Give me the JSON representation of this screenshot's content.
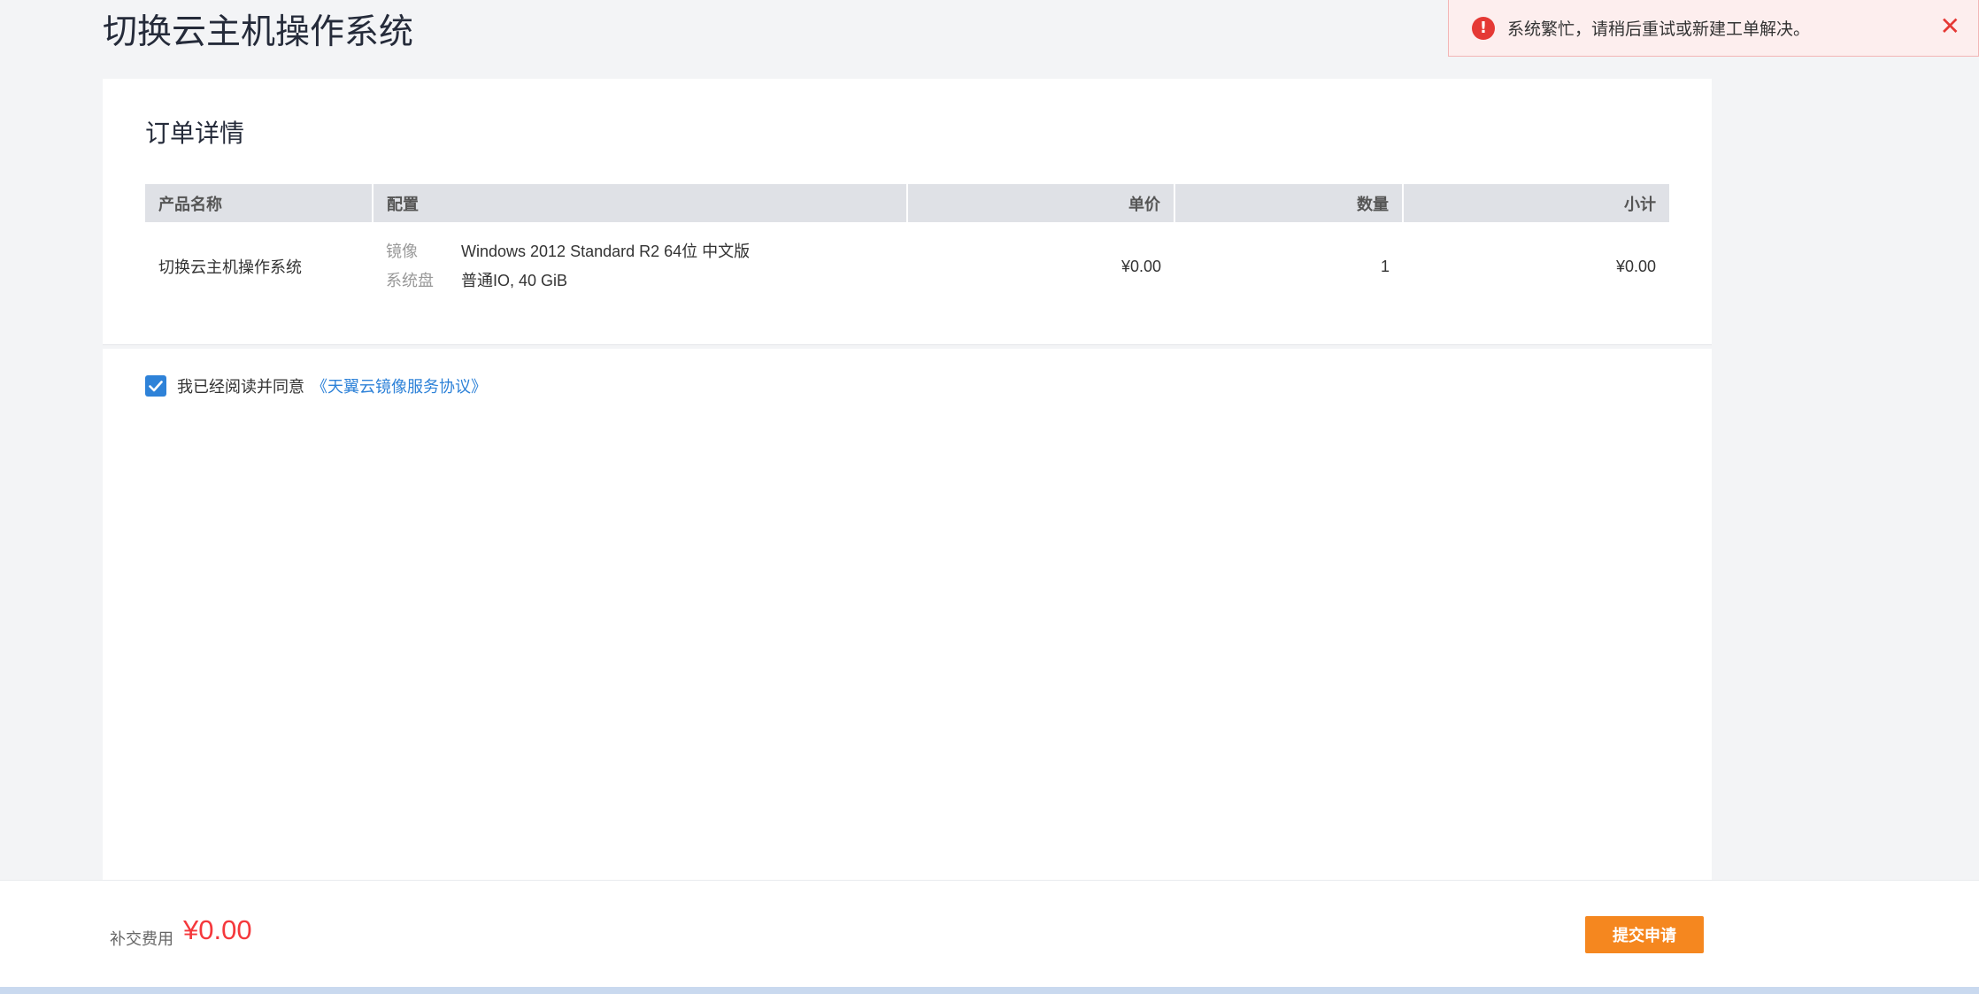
{
  "page": {
    "title": "切换云主机操作系统"
  },
  "toast": {
    "message": "系统繁忙，请稍后重试或新建工单解决。",
    "icon": "error-icon",
    "close_icon": "close-icon"
  },
  "order": {
    "title": "订单详情",
    "columns": {
      "product": "产品名称",
      "config": "配置",
      "unit_price": "单价",
      "quantity": "数量",
      "subtotal": "小计"
    },
    "row": {
      "product": "切换云主机操作系统",
      "config": [
        {
          "key": "镜像",
          "value": "Windows 2012 Standard R2 64位 中文版"
        },
        {
          "key": "系统盘",
          "value": "普通IO, 40 GiB"
        }
      ],
      "unit_price": "¥0.00",
      "quantity": "1",
      "subtotal": "¥0.00"
    }
  },
  "agreement": {
    "checked": true,
    "text": "我已经阅读并同意",
    "link": "《天翼云镜像服务协议》"
  },
  "footer": {
    "fee_label": "补交费用",
    "fee_value": "¥0.00",
    "submit_label": "提交申请"
  },
  "colors": {
    "accent": "#f5871f",
    "link": "#2e82d8",
    "price": "#f5383c",
    "subtotal": "#f58e1e",
    "error": "#e53935"
  }
}
